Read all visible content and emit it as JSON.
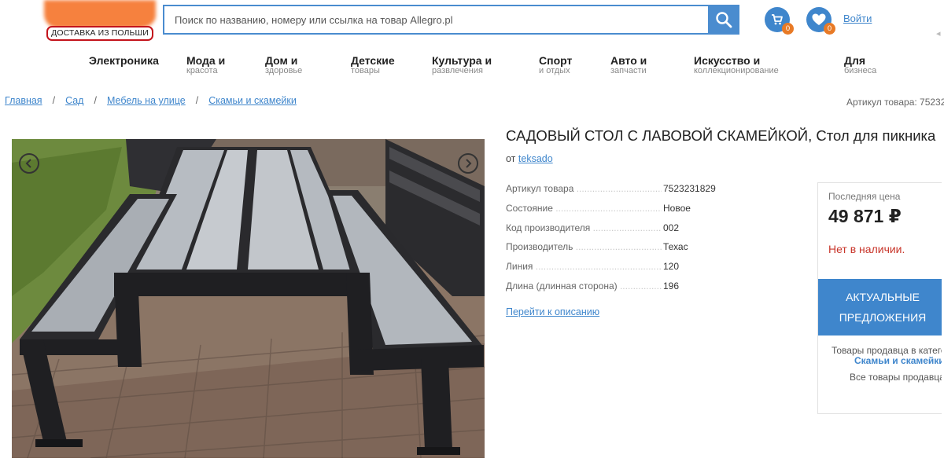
{
  "header": {
    "badge": "ДОСТАВКА ИЗ ПОЛЬШИ",
    "search_placeholder": "Поиск по названию, номеру или ссылка на товар Allegro.pl",
    "cart_count": "0",
    "favorites_count": "0",
    "login": "Войти"
  },
  "categories": [
    {
      "title": "Электроника",
      "sub": ""
    },
    {
      "title": "Мода и",
      "sub": "красота"
    },
    {
      "title": "Дом и",
      "sub": "здоровье"
    },
    {
      "title": "Детские",
      "sub": "товары"
    },
    {
      "title": "Культура и",
      "sub": "развлечения"
    },
    {
      "title": "Спорт",
      "sub": "и отдых"
    },
    {
      "title": "Авто и",
      "sub": "запчасти"
    },
    {
      "title": "Искусство и",
      "sub": "коллекционирование"
    },
    {
      "title": "Для",
      "sub": "бизнеса"
    }
  ],
  "breadcrumb": [
    "Главная",
    "Сад",
    "Мебель на улице",
    "Скамьи и скамейки"
  ],
  "article_top": "Артикул товара: 75232",
  "product": {
    "title": "САДОВЫЙ СТОЛ С ЛАВОВОЙ СКАМЕЙКОЙ, Стол для пикника",
    "seller_prefix": "от",
    "seller": "teksado",
    "specs": [
      {
        "k": "Артикул товара",
        "v": "7523231829"
      },
      {
        "k": "Состояние",
        "v": "Новое"
      },
      {
        "k": "Код производителя",
        "v": "002"
      },
      {
        "k": "Производитель",
        "v": "Техас"
      },
      {
        "k": "Линия",
        "v": "120"
      },
      {
        "k": "Длина (длинная сторона)",
        "v": "196"
      }
    ],
    "to_description": "Перейти к описанию"
  },
  "price_box": {
    "label": "Последняя цена",
    "price": "49 871 ₽",
    "stock": "Нет в наличии.",
    "offers_line1": "АКТУАЛЬНЫЕ",
    "offers_line2": "ПРЕДЛОЖЕНИЯ",
    "seller_goods": "Товары продавца в катего",
    "seller_category": "Скамьи и скамейки",
    "all_goods": "Все товары продавца"
  },
  "icons": {
    "search": "search-icon",
    "cart": "cart-icon",
    "favorites": "heart-icon",
    "prev": "chevron-left-icon",
    "next": "chevron-right-icon"
  },
  "colors": {
    "accent": "#3f86cc",
    "badge": "#e87a26",
    "logo": "#f6813e",
    "stock": "#c8352a"
  }
}
